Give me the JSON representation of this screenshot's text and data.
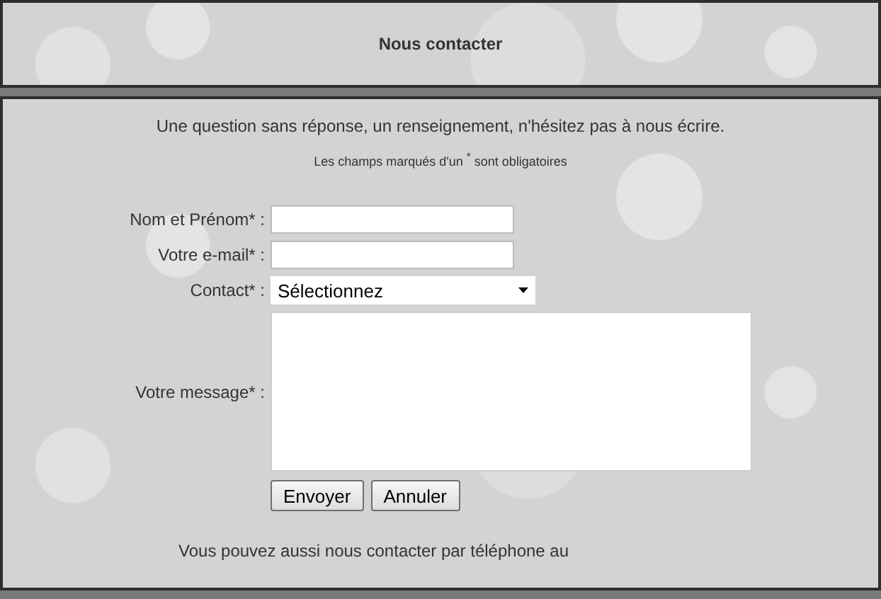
{
  "header": {
    "title": "Nous contacter"
  },
  "intro": "Une question sans réponse, un renseignement, n'hésitez pas à nous écrire.",
  "required_note": "Les champs marqués d'un $^{*}$ sont obligatoires",
  "fields": [
    {
      "kind": "text",
      "label": "Nom et Prénom* :"
    },
    {
      "kind": "text",
      "label": "Votre e-mail* :"
    },
    {
      "kind": "select",
      "label": "Contact* :",
      "value": "Sélectionnez"
    },
    {
      "kind": "textarea",
      "label": "Votre message* :"
    }
  ],
  "buttons": [
    "Envoyer",
    "Annuler"
  ],
  "footer_note": "Vous pouvez aussi nous contacter par téléphone au"
}
